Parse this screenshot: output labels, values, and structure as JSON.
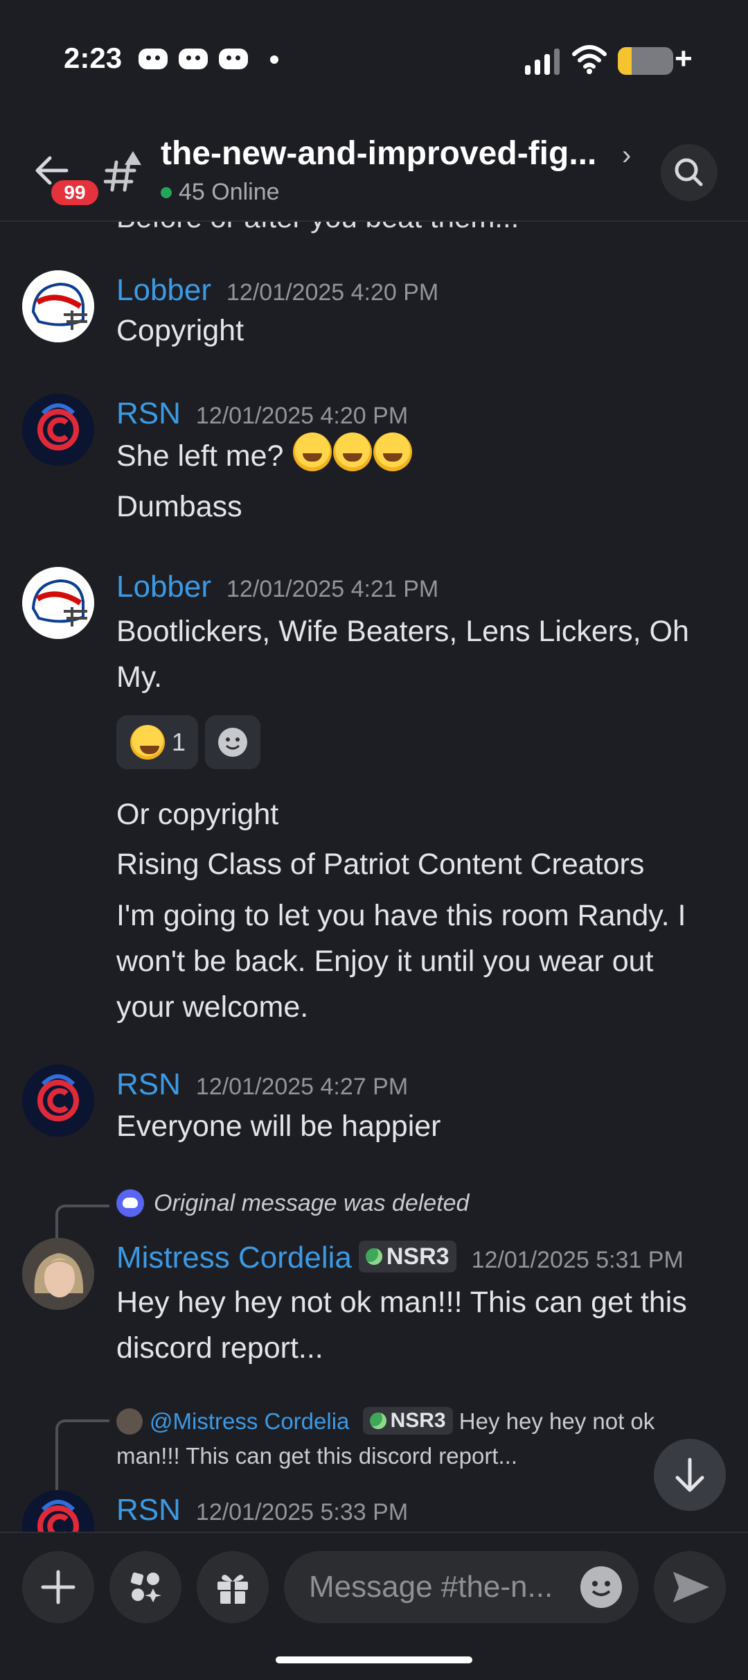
{
  "status_bar": {
    "time": "2:23"
  },
  "header": {
    "unread_badge": "99",
    "channel_name": "the-new-and-improved-fig...",
    "online_text": "45 Online"
  },
  "cut_off_text": "Before or after you beat them...",
  "messages": [
    {
      "author": "Lobber",
      "timestamp": "12/01/2025 4:20 PM",
      "lines": [
        "Copyright"
      ]
    },
    {
      "author": "RSN",
      "timestamp": "12/01/2025 4:20 PM",
      "lines": [
        "She left me?",
        "Dumbass"
      ]
    },
    {
      "author": "Lobber",
      "timestamp": "12/01/2025 4:21 PM",
      "lines": [
        "Bootlickers, Wife Beaters, Lens Lickers, Oh",
        "My."
      ],
      "reaction_count": "1",
      "followups": [
        "Or copyright",
        "Rising Class of Patriot Content Creators",
        "I'm going to let you have this room Randy.  I",
        "won't be back.  Enjoy it until you wear out",
        "your welcome."
      ]
    },
    {
      "author": "RSN",
      "timestamp": "12/01/2025 4:27 PM",
      "lines": [
        "Everyone will be happier"
      ]
    },
    {
      "reply_note": "Original message was deleted",
      "author": "Mistress Cordelia",
      "role_tag": "NSR3",
      "timestamp": "12/01/2025 5:31 PM",
      "lines": [
        "Hey hey hey not ok man!!! This can get this",
        "discord report..."
      ]
    },
    {
      "reply_mention": "@Mistress Cordelia",
      "reply_tag": "NSR3",
      "reply_text_1": "Hey hey hey not ok",
      "reply_text_2": "man!!! This can get this discord report...",
      "author": "RSN",
      "timestamp": "12/01/2025 5:33 PM"
    }
  ],
  "composer": {
    "placeholder": "Message #the-n..."
  },
  "colors": {
    "background": "#1d1e23",
    "username": "#3c9ae4",
    "badge": "#e5323c",
    "online": "#23a55a"
  },
  "icons": [
    "back-arrow-icon",
    "thread-hash-icon",
    "search-icon",
    "plus-icon",
    "apps-icon",
    "gift-icon",
    "emoji-icon",
    "send-icon",
    "arrow-down-icon"
  ]
}
